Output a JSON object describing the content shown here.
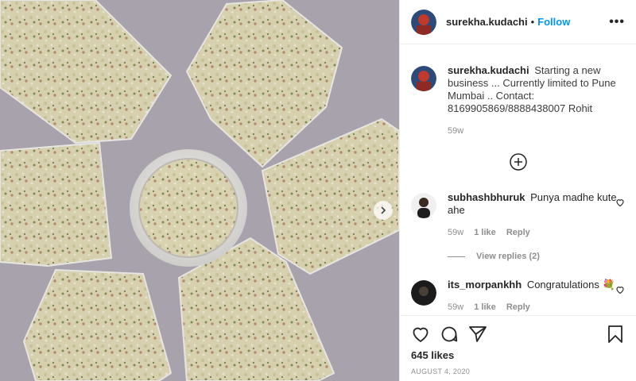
{
  "post": {
    "author": "surekha.kudachi",
    "separator": "•",
    "follow_label": "Follow",
    "more_label": "•••",
    "caption": {
      "username": "surekha.kudachi",
      "text": "Starting a new business ... Currently limited to Pune Mumbai .. Contact: 8169905869/8888438007 Rohit",
      "age": "59w"
    },
    "comments": [
      {
        "username": "subhashbhuruk",
        "text": "Punya madhe kute ahe",
        "age": "59w",
        "likes": "1 like",
        "reply_label": "Reply"
      },
      {
        "username": "its_morpankhh",
        "text": "Congratulations 💐",
        "age": "59w",
        "likes": "1 like",
        "reply_label": "Reply"
      }
    ],
    "view_replies": "View replies (2)",
    "like_count": "645 likes",
    "date": "AUGUST 4, 2020",
    "icons": {
      "like": "heart-icon",
      "comment": "comment-icon",
      "share": "share-icon",
      "save": "bookmark-icon",
      "load_more": "plus-circle-icon",
      "next": "chevron-right-icon"
    },
    "colors": {
      "accent": "#0095f6",
      "muted": "#8e8e8e",
      "photo_background": "#a7a2ab"
    }
  }
}
